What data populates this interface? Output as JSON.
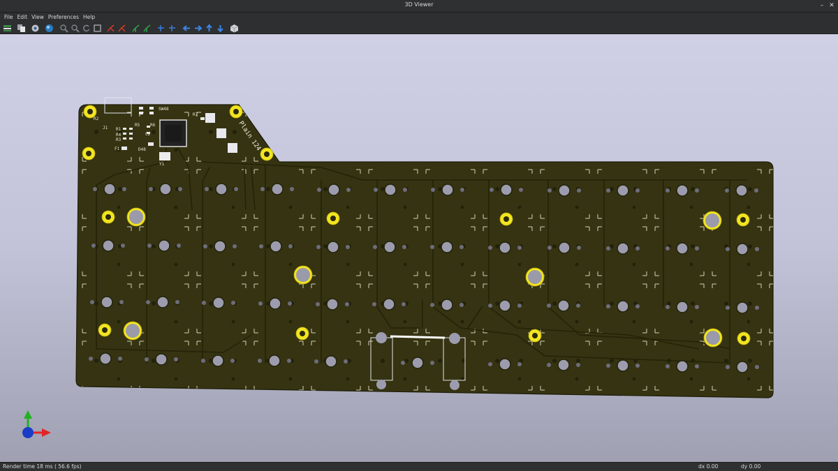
{
  "window": {
    "title": "3D Viewer"
  },
  "menu": {
    "items": [
      "File",
      "Edit",
      "View",
      "Preferences",
      "Help"
    ]
  },
  "toolbar": {
    "icons": [
      "reload-board-icon",
      "copy-image-icon",
      "settings-icon",
      "raytrace-icon",
      "zoom-in-icon",
      "zoom-out-icon",
      "redraw-icon",
      "zoom-fit-icon",
      "rotate-x-cw-icon",
      "rotate-x-ccw-icon",
      "rotate-y-cw-icon",
      "rotate-y-ccw-icon",
      "rotate-z-cw-icon",
      "rotate-z-ccw-icon",
      "pan-left-icon",
      "pan-right-icon",
      "pan-up-icon",
      "pan-down-icon",
      "orthographic-icon"
    ]
  },
  "board": {
    "silkscreen_title": "Plain 124",
    "labels": {
      "sw": "SW48",
      "r7": "R7",
      "r1": "R1",
      "r5": "R5",
      "r6": "R6",
      "r4": "R4",
      "r3": "R3",
      "r2": "R2",
      "c2": "C2",
      "f1": "F1",
      "d48": "D48",
      "j1": "J1",
      "y1": "Y1"
    }
  },
  "status": {
    "render": "Render time 18 ms ( 56.6 fps)",
    "dx": "dx 0.00",
    "dy": "dy 0.00"
  },
  "colors": {
    "board": "#353311",
    "pad_ring": "#f2e521",
    "hole": "#9a9aaa"
  }
}
